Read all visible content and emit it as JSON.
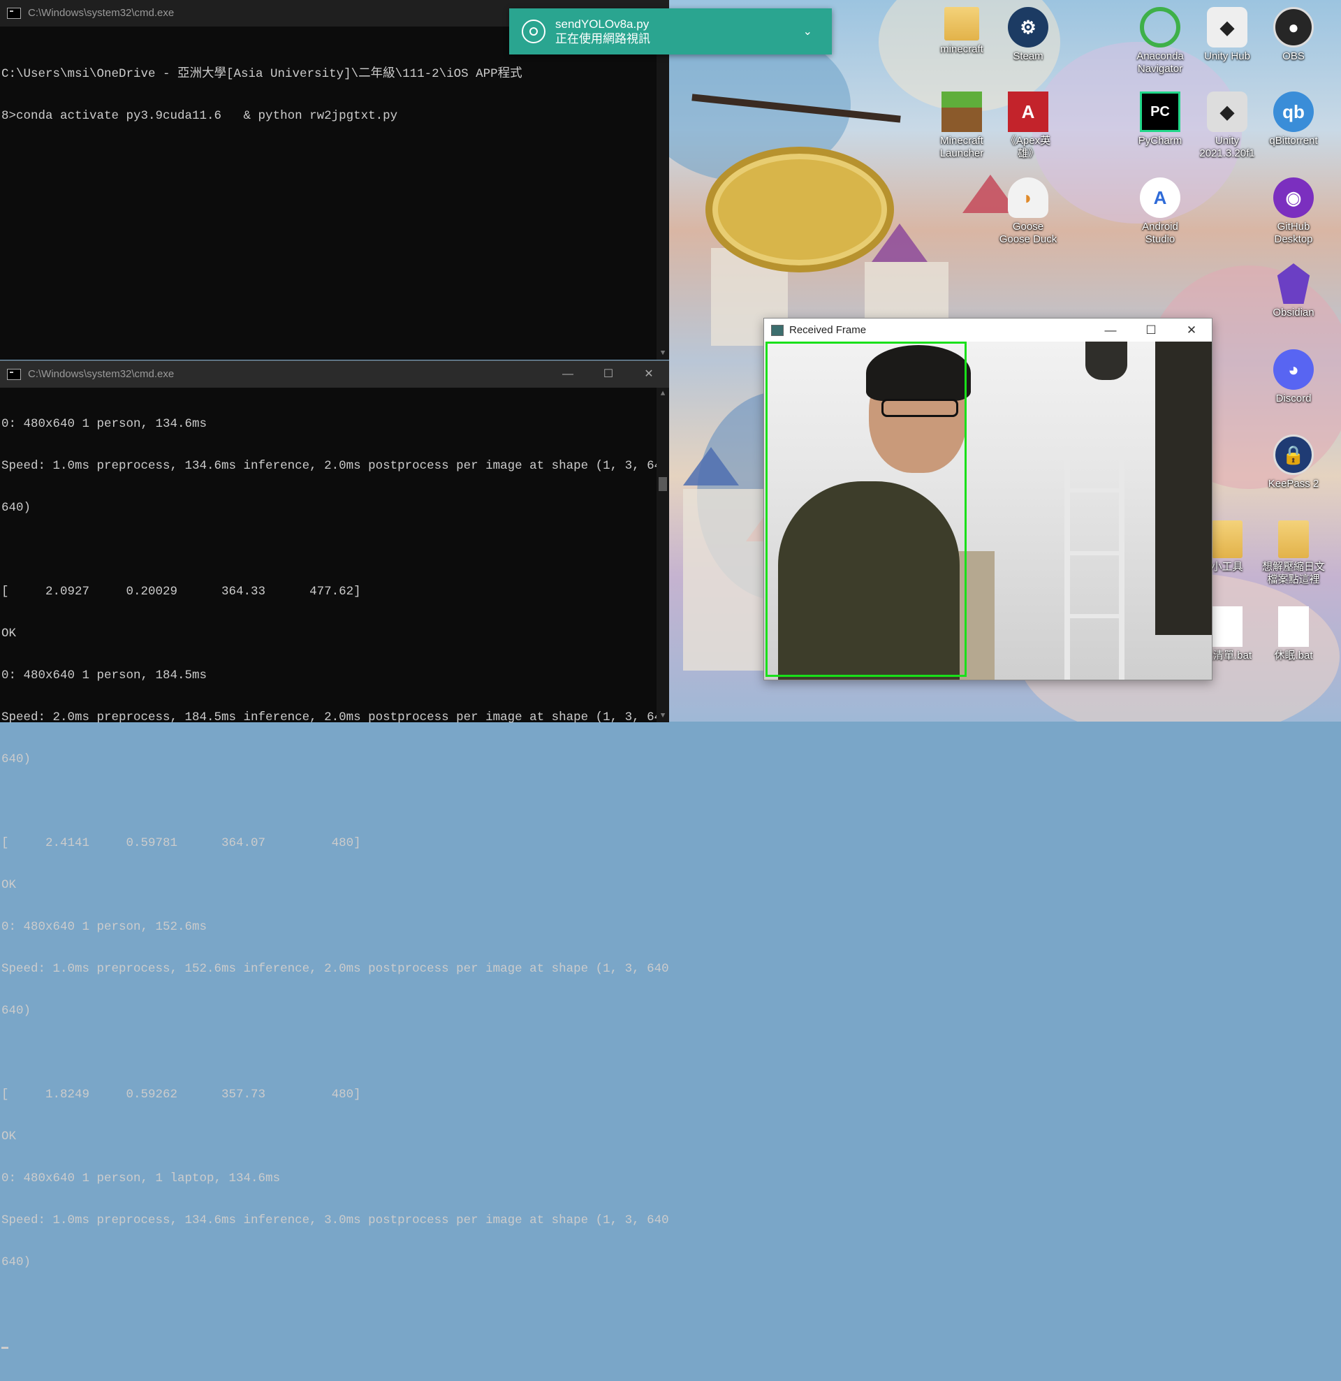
{
  "cmd_top": {
    "title": "C:\\Windows\\system32\\cmd.exe",
    "lines": [
      "C:\\Users\\msi\\OneDrive - 亞洲大學[Asia University]\\二年級\\111-2\\iOS APP程式",
      "8>conda activate py3.9cuda11.6   & python rw2jpgtxt.py"
    ]
  },
  "cmd_bottom": {
    "title": "C:\\Windows\\system32\\cmd.exe",
    "lines": [
      "0: 480x640 1 person, 134.6ms",
      "Speed: 1.0ms preprocess, 134.6ms inference, 2.0ms postprocess per image at shape (1, 3, 640,",
      "640)",
      "",
      "[     2.0927     0.20029      364.33      477.62]",
      "OK",
      "0: 480x640 1 person, 184.5ms",
      "Speed: 2.0ms preprocess, 184.5ms inference, 2.0ms postprocess per image at shape (1, 3, 640,",
      "640)",
      "",
      "[     2.4141     0.59781      364.07         480]",
      "OK",
      "0: 480x640 1 person, 152.6ms",
      "Speed: 1.0ms preprocess, 152.6ms inference, 2.0ms postprocess per image at shape (1, 3, 640,",
      "640)",
      "",
      "[     1.8249     0.59262      357.73         480]",
      "OK",
      "0: 480x640 1 person, 1 laptop, 134.6ms",
      "Speed: 1.0ms preprocess, 134.6ms inference, 3.0ms postprocess per image at shape (1, 3, 640,",
      "640)"
    ]
  },
  "toast": {
    "app": "sendYOLOv8a.py",
    "message": "正在使用網路視訊"
  },
  "frame_window": {
    "title": "Received Frame"
  },
  "desktop_icons": [
    {
      "label": "minecraft",
      "icon": "folder-icon"
    },
    {
      "label": "Steam",
      "icon": "steam-icon"
    },
    {
      "label": "Anaconda\nNavigator",
      "icon": "anaconda-icon"
    },
    {
      "label": "Unity Hub",
      "icon": "unity-hub-icon"
    },
    {
      "label": "OBS",
      "icon": "obs-icon"
    },
    {
      "label": "Minecraft\nLauncher",
      "icon": "minecraft-icon"
    },
    {
      "label": "《Apex英\n雄》",
      "icon": "apex-icon"
    },
    {
      "label": "PyCharm",
      "icon": "pycharm-icon"
    },
    {
      "label": "Unity\n2021.3.20f1",
      "icon": "unity-icon"
    },
    {
      "label": "qBittorrent",
      "icon": "qbittorrent-icon"
    },
    {
      "label": "Goose\nGoose Duck",
      "icon": "goose-icon"
    },
    {
      "label": "Android\nStudio",
      "icon": "android-studio-icon"
    },
    {
      "label": "GitHub\nDesktop",
      "icon": "github-icon"
    },
    {
      "label": "Obsidian",
      "icon": "obsidian-icon"
    },
    {
      "label": "Discord",
      "icon": "discord-icon"
    },
    {
      "label": "KeePass 2",
      "icon": "keepass-icon"
    },
    {
      "label": "小工具",
      "icon": "folder-icon"
    },
    {
      "label": "想解壓縮日文\n檔案點這裡",
      "icon": "folder-icon"
    },
    {
      "label": "後清單.bat",
      "icon": "file-icon"
    },
    {
      "label": "休眠.bat",
      "icon": "file-icon"
    }
  ],
  "colors": {
    "toast": "#2aa590",
    "detection_box": "#19e01a",
    "console_bg": "#0c0c0c"
  }
}
